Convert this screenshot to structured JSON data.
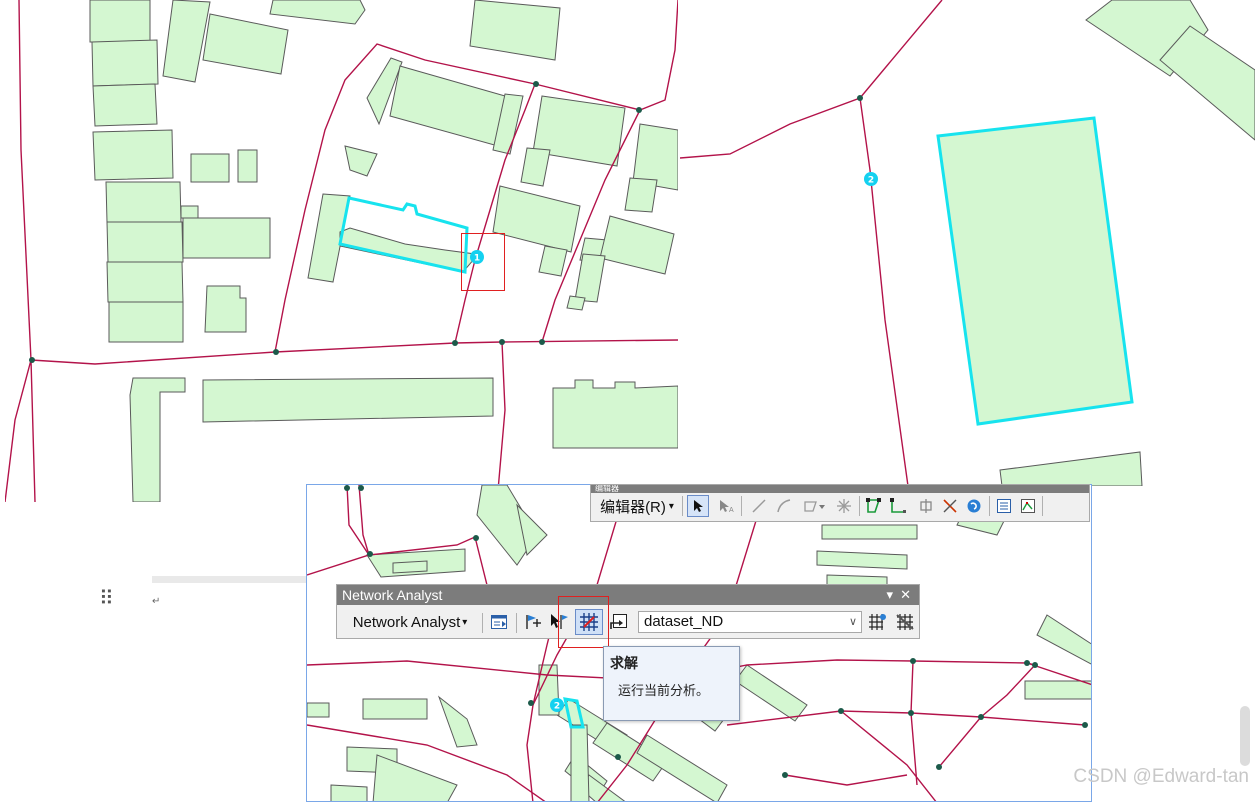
{
  "map_labels": {
    "stop_1": "1",
    "stop_2": "2",
    "stop_3": "2"
  },
  "editor_toolbar": {
    "title": "编辑器",
    "menu_label": "编辑器(R)",
    "menu_arrow": "▾"
  },
  "network_analyst_toolbar": {
    "title": "Network Analyst",
    "menu_label": "Network Analyst",
    "menu_arrow": "▾",
    "pin_glyph": "▾",
    "close_glyph": "✕",
    "dataset": "dataset_ND",
    "icons": [
      "network-analyst-window-icon",
      "new-route-icon",
      "move-location-icon",
      "solve-icon",
      "directions-icon",
      "build-network-icon",
      "network-identify-icon"
    ]
  },
  "tooltip": {
    "title": "求解",
    "description": "运行当前分析。"
  },
  "document": {
    "paragraph_mark": "↵",
    "drag_handle": "⠿"
  },
  "watermark": "CSDN @Edward-tan",
  "colors": {
    "building_fill": "#d4f7d1",
    "road": "#b3134a",
    "selection": "#17e3ee",
    "stop": "#14d1f0",
    "highlight_box": "#e02020"
  }
}
